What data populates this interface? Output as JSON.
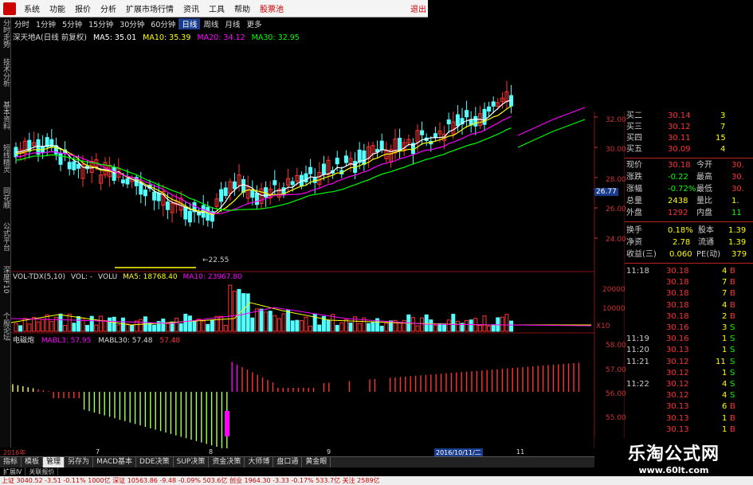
{
  "menu": {
    "items": [
      "系统",
      "功能",
      "报价",
      "分析",
      "扩展市场行情",
      "资讯",
      "工具",
      "帮助"
    ],
    "highlight": "股票池",
    "exit": "退出"
  },
  "left_tabs": [
    "分时走势",
    "技术分析",
    "基本资料",
    "短线精灵",
    "同花顺",
    "公式平台",
    "深度F10",
    "个股论坛"
  ],
  "periods": [
    "分时",
    "1分钟",
    "5分钟",
    "15分钟",
    "30分钟",
    "60分钟",
    "日线",
    "周线",
    "月线",
    "更多"
  ],
  "active_period": "日线",
  "stock": {
    "name_legend": "深天地A(日线 前复权)",
    "ma5": "MA5: 35.01",
    "ma10": "MA10: 35.39",
    "ma20": "MA20: 34.12",
    "ma30": "MA30: 32.95"
  },
  "price_axis": [
    "32.00",
    "30.00",
    "28.00",
    "26.00",
    "24.00"
  ],
  "current_price_tag": "26.77",
  "low_label": "←22.55",
  "vol_legend": {
    "name": "VOL-TDX(5,10)",
    "vol": "VOL: -",
    "volu": "VOLU",
    "ma5": "MA5: 18768.40",
    "ma10": "MA10: 23967.80"
  },
  "vol_axis": [
    "20000",
    "10000",
    "X10"
  ],
  "ind_legend": {
    "name": "电磁炮",
    "mabl3": "MABL3: 57.95",
    "mabl30": "MABL30: 57.48",
    "v": "57.48"
  },
  "ind_axis": [
    "58.00",
    "57.00",
    "56.00",
    "55.00"
  ],
  "quote": {
    "bids": [
      {
        "label": "买二",
        "price": "30.14",
        "vol": "3"
      },
      {
        "label": "买三",
        "price": "30.12",
        "vol": "7"
      },
      {
        "label": "买四",
        "price": "30.11",
        "vol": "15"
      },
      {
        "label": "买五",
        "price": "30.09",
        "vol": "4"
      }
    ],
    "stats": [
      {
        "l1": "现价",
        "v1": "30.18",
        "l2": "今开",
        "v2": "30."
      },
      {
        "l1": "涨跌",
        "v1": "-0.22",
        "l2": "最高",
        "v2": "30."
      },
      {
        "l1": "涨幅",
        "v1": "-0.72%",
        "l2": "最低",
        "v2": "30."
      },
      {
        "l1": "总量",
        "v1": "2438",
        "l2": "量比",
        "v2": "1."
      },
      {
        "l1": "外盘",
        "v1": "1292",
        "l2": "内盘",
        "v2": "11"
      }
    ],
    "stats2": [
      {
        "l1": "换手",
        "v1": "0.18%",
        "l2": "股本",
        "v2": "1.39"
      },
      {
        "l1": "净资",
        "v1": "2.78",
        "l2": "流通",
        "v2": "1.39"
      },
      {
        "l1": "收益(三)",
        "v1": "0.060",
        "l2": "PE(动)",
        "v2": "379"
      }
    ],
    "ticks": [
      {
        "t": "11:18",
        "p": "30.18",
        "v": "4",
        "d": "B"
      },
      {
        "t": "",
        "p": "30.18",
        "v": "7",
        "d": "B"
      },
      {
        "t": "",
        "p": "30.18",
        "v": "7",
        "d": "B"
      },
      {
        "t": "",
        "p": "30.18",
        "v": "4",
        "d": "B"
      },
      {
        "t": "",
        "p": "30.18",
        "v": "2",
        "d": "B"
      },
      {
        "t": "",
        "p": "30.16",
        "v": "3",
        "d": "S"
      },
      {
        "t": "11:19",
        "p": "30.16",
        "v": "1",
        "d": "S"
      },
      {
        "t": "11:20",
        "p": "30.13",
        "v": "1",
        "d": "S"
      },
      {
        "t": "11:21",
        "p": "30.12",
        "v": "11",
        "d": "S"
      },
      {
        "t": "",
        "p": "30.12",
        "v": "1",
        "d": "S"
      },
      {
        "t": "11:22",
        "p": "30.12",
        "v": "4",
        "d": "S"
      },
      {
        "t": "",
        "p": "30.12",
        "v": "4",
        "d": "S"
      },
      {
        "t": "",
        "p": "30.13",
        "v": "6",
        "d": "B"
      },
      {
        "t": "",
        "p": "30.13",
        "v": "1",
        "d": "B"
      },
      {
        "t": "",
        "p": "30.13",
        "v": "1",
        "d": "B"
      }
    ]
  },
  "date_bar": {
    "start": "2016年",
    "m7": "7",
    "m8": "8",
    "m9": "9",
    "cursor": "2016/10/11/二",
    "m11": "11"
  },
  "bottom_tabs": [
    "指标",
    "模板",
    "管理",
    "另存为",
    "MACD基本",
    "DDE决策",
    "SUP决策",
    "资金决策",
    "大师博",
    "盘口通",
    "黄金眼"
  ],
  "active_bottom_tab": "管理",
  "sub_tabs": [
    "扩展Ⅳ",
    "关联报价"
  ],
  "status_text": "上证 3040.52  -3.51  -0.11%  1000亿  深证 10563.86  -9.48  -0.09%  503.6亿  创业 1964.30  -3.33  -0.17%  533.7亿  关注 2589亿",
  "watermark": {
    "title": "乐淘公式网",
    "url": "www.60lt.com"
  },
  "colors": {
    "up": "#ff3232",
    "down": "#54ffff",
    "ma5": "#ffffff",
    "ma10": "#ffff00",
    "ma20": "#ff00ff",
    "ma30": "#00ff00"
  }
}
